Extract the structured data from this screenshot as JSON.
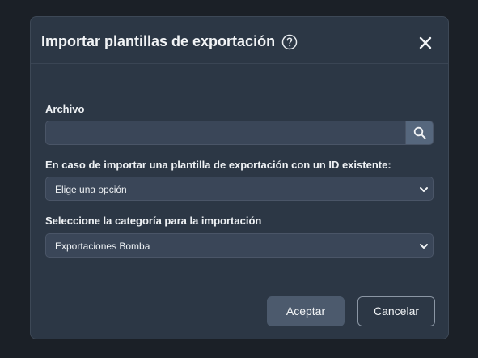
{
  "dialog": {
    "title": "Importar plantillas de exportación",
    "help_icon": "question-circle-icon",
    "close_icon": "close-icon"
  },
  "file_field": {
    "label": "Archivo",
    "value": "",
    "placeholder": "",
    "button_icon": "search-icon"
  },
  "existing_id_field": {
    "label": "En caso de importar una plantilla de exportación con un ID existente:",
    "selected": "Elige una opción"
  },
  "category_field": {
    "label": "Seleccione la categoría para la importación",
    "selected": "Exportaciones Bomba"
  },
  "buttons": {
    "accept": "Aceptar",
    "cancel": "Cancelar"
  },
  "colors": {
    "backdrop": "#1b2027",
    "modal_bg": "#2c3745",
    "input_bg": "#3a4658",
    "primary_button": "#4c5a6d"
  }
}
